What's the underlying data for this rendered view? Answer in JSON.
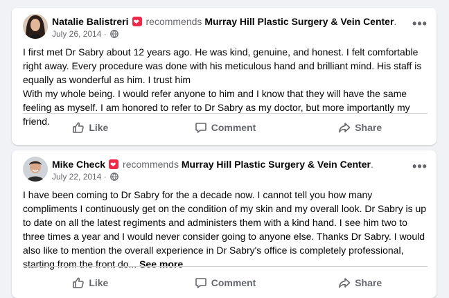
{
  "posts": [
    {
      "author": "Natalie Balistreri",
      "verb": "recommends",
      "page": "Murray Hill Plastic Surgery & Vein Center",
      "page_suffix": ".",
      "date": "July 26, 2014 ·",
      "paragraphs": [
        "I first met Dr Sabry about 12 years ago. He was kind, genuine, and honest. I felt comfortable right away. Every procedure was done with his meticulous hand and brilliant mind. His staff is equally as wonderful as him. I trust him",
        "With my whole being. I would refer anyone to him and I know that they will have the same feeling as myself. I am honored to refer to Dr Sabry as my doctor, but more importantly my friend."
      ],
      "see_more": "",
      "actions": {
        "like": "Like",
        "comment": "Comment",
        "share": "Share"
      }
    },
    {
      "author": "Mike Check",
      "verb": "recommends",
      "page": "Murray Hill Plastic Surgery & Vein Center",
      "page_suffix": ".",
      "date": "July 22, 2014 ·",
      "paragraphs": [
        "I have been coming to Dr Sabry for the a decade now. I cannot tell you how many compliments I continuously get on the condition of my skin and my overall look. Dr Sabry is up to date on all the latest regiments and administers them with a kind hand. I see him two to three times a year and I would never consider going to anyone else.  Thanks Dr Sabry. I would also like to mention the overall experience in Dr Sabry's office is completely professional, starting from the front do..."
      ],
      "see_more": "See more",
      "actions": {
        "like": "Like",
        "comment": "Comment",
        "share": "Share"
      }
    }
  ],
  "icons": {
    "badge": "recommendation-heart-icon",
    "privacy": "globe-icon",
    "menu": "more-options-icon",
    "like": "thumbs-up-icon",
    "comment": "comment-bubble-icon",
    "share": "share-arrow-icon"
  },
  "colors": {
    "background": "#f0f2f5",
    "card": "#ffffff",
    "secondary_text": "#65676b",
    "badge": "#f02849",
    "divider": "#ced0d4"
  }
}
